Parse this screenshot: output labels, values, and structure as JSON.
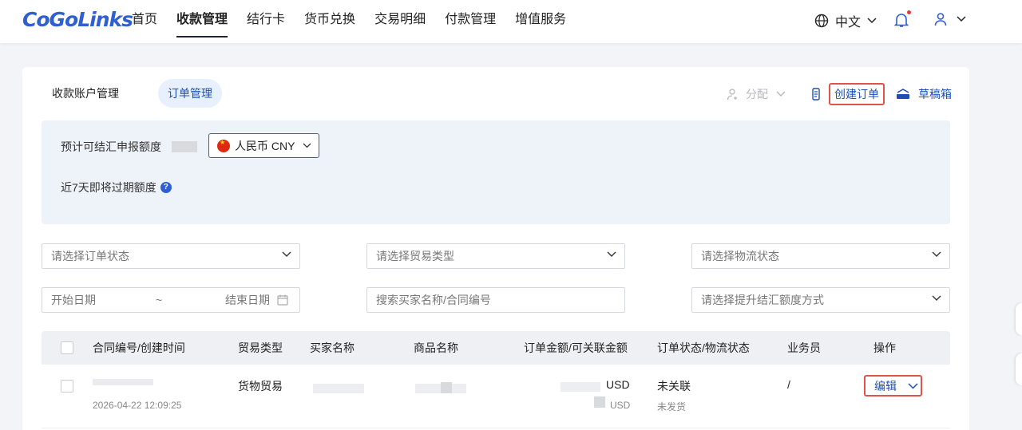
{
  "brand": {
    "logo": "CoGoLinks",
    "color": "#2f5fd1"
  },
  "nav": {
    "items": [
      "首页",
      "收款管理",
      "结行卡",
      "货币兑换",
      "交易明细",
      "付款管理",
      "增值服务"
    ],
    "active_index": 1,
    "language": "中文",
    "icons": {
      "language": "globe-icon",
      "notifications": "bell-icon",
      "account": "user-icon"
    }
  },
  "subtabs": {
    "account_mgmt": "收款账户管理",
    "order_mgmt": "订单管理",
    "active": "订单管理"
  },
  "actions": {
    "assign": "分配",
    "create_order": "创建订单",
    "drafts": "草稿箱"
  },
  "quota": {
    "expected_label": "预计可结汇申报额度",
    "currency": "人民币 CNY",
    "expiring_label": "近7天即将过期额度"
  },
  "filters": {
    "order_status_placeholder": "请选择订单状态",
    "trade_type_placeholder": "请选择贸易类型",
    "logistics_placeholder": "请选择物流状态",
    "start_date_placeholder": "开始日期",
    "range_sep": "~",
    "end_date_placeholder": "结束日期",
    "search_placeholder": "搜索买家名称/合同编号",
    "quota_method_placeholder": "请选择提升结汇额度方式"
  },
  "table": {
    "columns": [
      "合同编号/创建时间",
      "贸易类型",
      "买家名称",
      "商品名称",
      "订单金额/可关联金额",
      "订单状态/物流状态",
      "业务员",
      "操作"
    ],
    "rows": [
      {
        "created": "2026-04-22 12:09:25",
        "trade_type": "货物贸易",
        "amount_currency": "USD",
        "linkable_currency": "USD",
        "order_status": "未关联",
        "logistics_status": "未发货",
        "salesperson": "/",
        "action": "编辑"
      }
    ]
  },
  "colors": {
    "accent": "#1f4fb3",
    "highlight_border": "#e0534c",
    "panel_bg": "#eef2f9"
  }
}
